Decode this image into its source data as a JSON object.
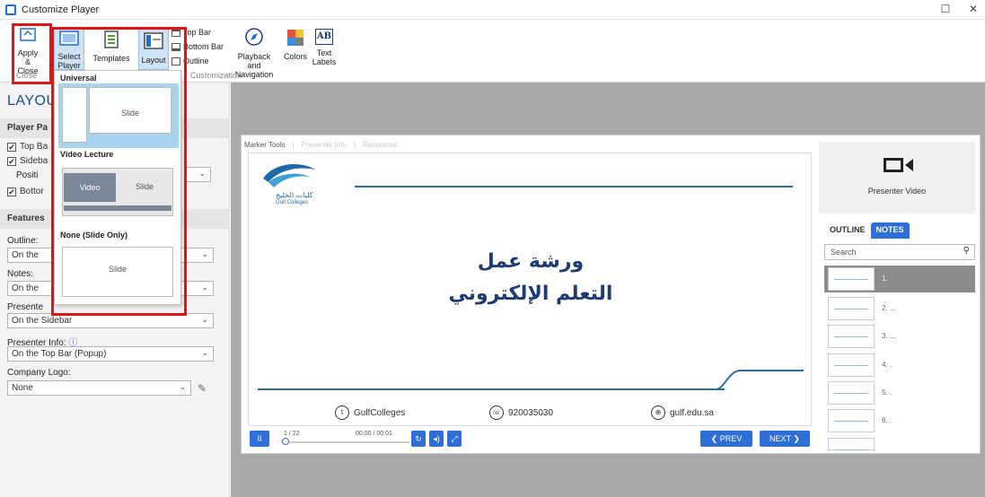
{
  "window": {
    "title": "Customize Player",
    "maximize_glyph": "☐",
    "close_glyph": "✕"
  },
  "ribbon": {
    "apply_close": {
      "line1": "Apply",
      "line2": "& Close",
      "icon": "apply-close-icon"
    },
    "select_player": {
      "line1": "Select",
      "line2": "Player ▾",
      "icon": "select-player-icon"
    },
    "templates": {
      "label": "Templates",
      "icon": "templates-icon"
    },
    "layout": {
      "label": "Layout",
      "icon": "layout-icon"
    },
    "bar_options": [
      "Top Bar",
      "Bottom Bar",
      "Outline"
    ],
    "playback_nav": {
      "line1": "Playback and",
      "line2": "Navigation",
      "icon": "compass-icon"
    },
    "colors": {
      "label": "Colors",
      "icon": "colors-icon"
    },
    "text_labels": {
      "line1": "Text",
      "line2": "Labels",
      "icon_text": "AB"
    },
    "group_close": "Close",
    "group_customization": "Customization"
  },
  "left_panel": {
    "title": "LAYOUT",
    "player_panels_header": "Player Pa",
    "top_bar_label": "Top Ba",
    "sidebar_label": "Sideba",
    "position_label": "Positi",
    "bottom_bar_label": "Bottor",
    "features_header": "Features",
    "outline_label": "Outline:",
    "outline_value": "On the",
    "notes_label": "Notes:",
    "notes_value": "On the",
    "presenter_video_label": "Presente",
    "presenter_video_value": "On the Sidebar",
    "presenter_info_label": "Presenter Info:",
    "presenter_info_value": "On the Top Bar (Popup)",
    "company_logo_label": "Company Logo:",
    "company_logo_value": "None"
  },
  "popup": {
    "universal_header": "Universal",
    "universal_slide": "Slide",
    "video_lecture_header": "Video Lecture",
    "video_label": "Video",
    "video_slide_label": "Slide",
    "none_header": "None (Slide Only)",
    "none_slide": "Slide"
  },
  "player": {
    "tabs": [
      "Marker Tools",
      "Presenter Info",
      "Resources"
    ],
    "logo_ar": "كليات الخليج",
    "logo_en": "Gulf Colleges",
    "title_line1": "ورشة عمل",
    "title_line2": "التعلم الإلكتروني",
    "contact_twitter": "GulfColleges",
    "contact_phone": "920035030",
    "contact_web": "gulf.edu.sa",
    "pause_glyph": "II",
    "slide_counter": "1 / 22",
    "time": "00:00 / 00:01",
    "prev_label": "❮ PREV",
    "next_label": "NEXT ❯",
    "presenter_video_label": "Presenter Video",
    "side_tab_outline": "OUTLINE",
    "side_tab_notes": "NOTES",
    "search_placeholder": "Search",
    "outline_items": [
      "1.",
      "2. ...",
      "3. ...",
      "4.   .",
      "5.   .",
      "6.   ."
    ]
  },
  "colors": {
    "accent_blue": "#2d6fd6",
    "highlight_red": "#e01515",
    "stage_gray": "#a9a9a9"
  }
}
